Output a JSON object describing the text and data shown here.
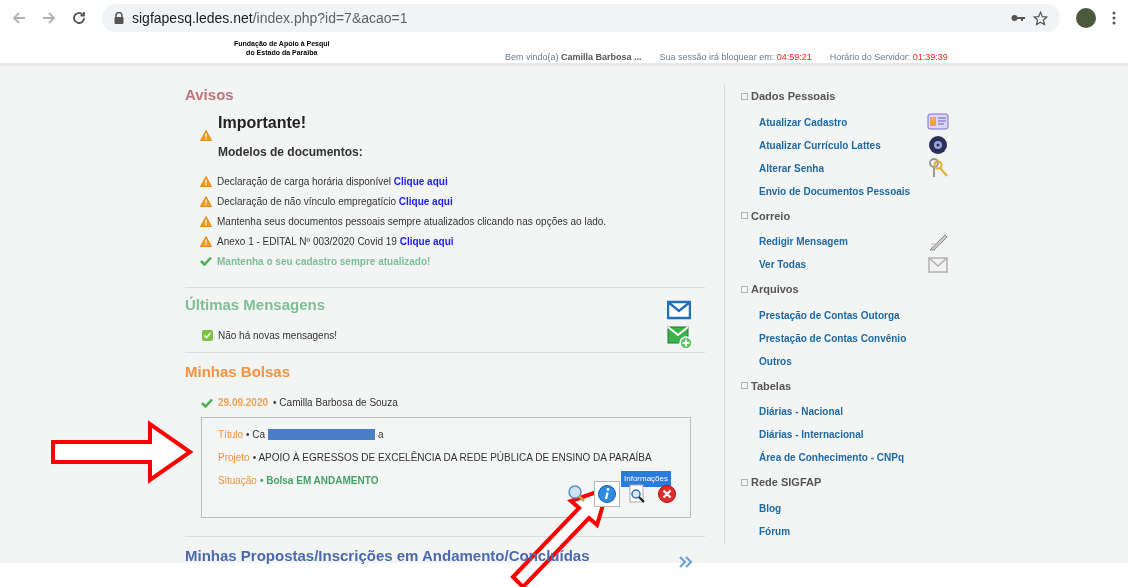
{
  "browser": {
    "url_host": "sigfapesq.ledes.net",
    "url_path": "/index.php?id=7&acao=1"
  },
  "header": {
    "logo_lines": [
      "Fundação de Apoio à Pesqui",
      "do Estado da Paraiba"
    ],
    "welcome_label": "Bem vindo(a)",
    "user": "Camilla Barbosa ...",
    "session_label": "Sua sessão irá bloquear em:",
    "session_time": "04:59:21",
    "server_label": "Horário do Servidor:",
    "server_time": "01:39:39"
  },
  "avisos": {
    "title": "Avisos",
    "important": "Importante!",
    "subtitle": "Modelos de documentos:",
    "items": [
      {
        "kind": "warning",
        "text": "Declaração de carga horária disponível",
        "link": "Clique aqui"
      },
      {
        "kind": "warning",
        "text": "Declaração de não vínculo empregatício",
        "link": "Clique aqui"
      },
      {
        "kind": "warning",
        "text": "Mantenha seus documentos pessoais sempre atualizados clicando nas opções ao lado."
      },
      {
        "kind": "warning",
        "text": "Anexo 1 - EDITAL Nº 003/2020 Covid 19",
        "link": "Clique aqui"
      },
      {
        "kind": "success",
        "text": "Mantenha o seu cadastro sempre atualizado!"
      }
    ]
  },
  "messages": {
    "title": "Últimas Mensagens",
    "empty": "Não há novas mensagens!"
  },
  "bolsas": {
    "title": "Minhas Bolsas",
    "date": "29.09.2020",
    "name": "• Camilla Barbosa de Souza",
    "title_label": "Título",
    "title_start": "• Ca",
    "title_end": "a",
    "project_label": "Projeto",
    "project": "• APOIO À EGRESSOS DE EXCELÊNCIA DA REDE PÚBLICA DE ENSINO DA PARAÍBA",
    "status_label": "Situação",
    "status": "• Bolsa EM ANDAMENTO",
    "tooltip": "Informações",
    "actions": [
      {
        "kind": "zoom",
        "selected": false
      },
      {
        "kind": "info",
        "selected": true
      },
      {
        "kind": "preview",
        "selected": false
      },
      {
        "kind": "cancel",
        "selected": false
      }
    ]
  },
  "proposals": {
    "title": "Minhas Propostas/Inscrições em Andamento/Concluídas"
  },
  "sidebar": [
    {
      "title": "Dados Pessoais",
      "items": [
        {
          "label": "Atualizar Cadastro",
          "kind": "card"
        },
        {
          "label": "Atualizar Currículo Lattes",
          "kind": "disc"
        },
        {
          "label": "Alterar Senha",
          "kind": "keys"
        },
        {
          "label": "Envio de Documentos Pessoais"
        }
      ]
    },
    {
      "title": "Correio",
      "items": [
        {
          "label": "Redigir Mensagem",
          "kind": "pen"
        },
        {
          "label": "Ver Todas",
          "kind": "mail"
        }
      ]
    },
    {
      "title": "Arquivos",
      "items": [
        {
          "label": "Prestação de Contas Outorga"
        },
        {
          "label": "Prestação de Contas Convênio"
        },
        {
          "label": "Outros"
        }
      ]
    },
    {
      "title": "Tabelas",
      "items": [
        {
          "label": "Diárias - Nacional"
        },
        {
          "label": "Diárias - Internacional"
        },
        {
          "label": "Área de Conhecimento - CNPq"
        }
      ]
    },
    {
      "title": "Rede SIGFAP",
      "items": [
        {
          "label": "Blog"
        },
        {
          "label": "Fórum"
        }
      ]
    }
  ]
}
